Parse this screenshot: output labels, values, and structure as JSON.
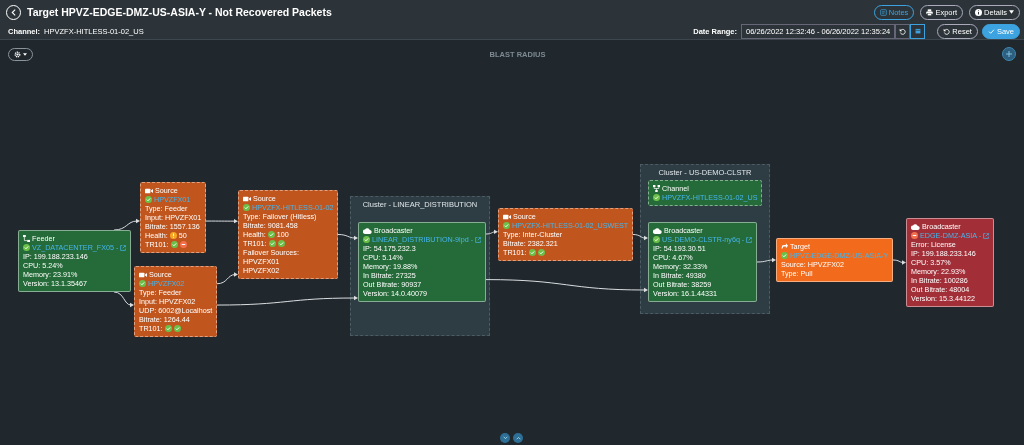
{
  "header": {
    "title": "Target HPVZ-EDGE-DMZ-US-ASIA-Y - Not Recovered Packets",
    "buttons": [
      {
        "kind": "notes",
        "label": "Notes"
      },
      {
        "kind": "export",
        "label": "Export"
      },
      {
        "kind": "details",
        "label": "Details"
      }
    ]
  },
  "filter": {
    "channel_label": "Channel:",
    "channel": "HPVZFX-HITLESS-01-02_US",
    "date_label": "Date Range:",
    "date_range": "06/26/2022 12:32:46 - 06/26/2022 12:35:24",
    "buttons": [
      {
        "kind": "reset",
        "label": "Reset"
      },
      {
        "kind": "save",
        "label": "Save"
      }
    ]
  },
  "canvas": {
    "title": "BLAST RADIUS"
  },
  "clusters": [
    {
      "title": "Cluster - LINEAR_DISTRIBUTION"
    },
    {
      "title": "Cluster - US-DEMO-CLSTR"
    }
  ],
  "nodes": [
    {
      "kind": "feeder",
      "label": "Feeder",
      "color": "#256b39",
      "ok": true,
      "name": "VZ_DATACENTER_FX05 -",
      "link": true,
      "lines": [
        {
          "text": "IP: 199.188.233.146"
        },
        {
          "text": "CPU: 5.24%"
        },
        {
          "text": "Memory: 23.91%"
        },
        {
          "text": "Version: 13.1.35467"
        }
      ]
    },
    {
      "kind": "source",
      "label": "Source",
      "color": "#c0561e",
      "ok": true,
      "name": "HPVZFX01",
      "link": false,
      "lines": [
        {
          "text": "Type: Feeder"
        },
        {
          "text": "Input: HPVZFX01"
        },
        {
          "text": "Bitrate: 1557.136"
        },
        {
          "text": "Health:",
          "icons": [
            {
              "kind": "warning"
            }
          ],
          "value": "50"
        },
        {
          "text": "TR101:",
          "icons": [
            {
              "kind": "ok"
            },
            {
              "kind": "error"
            }
          ]
        }
      ]
    },
    {
      "kind": "source",
      "label": "Source",
      "color": "#c0561e",
      "ok": true,
      "name": "HPVZFX02",
      "link": false,
      "lines": [
        {
          "text": "Type: Feeder"
        },
        {
          "text": "Input: HPVZFX02"
        },
        {
          "text": "UDP: 6002@Localhost"
        },
        {
          "text": "Bitrate: 1264.44"
        },
        {
          "text": "TR101:",
          "icons": [
            {
              "kind": "ok"
            },
            {
              "kind": "ok"
            }
          ]
        }
      ]
    },
    {
      "kind": "source",
      "label": "Source",
      "color": "#c0561e",
      "ok": true,
      "name": "HPVZFX-HITLESS-01-02",
      "link": false,
      "lines": [
        {
          "text": "Type: Failover (Hitless)"
        },
        {
          "text": "Bitrate: 9081.458"
        },
        {
          "text": "Health:",
          "icons": [
            {
              "kind": "ok"
            }
          ],
          "value": "100"
        },
        {
          "text": "TR101:",
          "icons": [
            {
              "kind": "ok"
            },
            {
              "kind": "ok"
            }
          ]
        },
        {
          "text": "Failover Sources:"
        },
        {
          "text": "HPVZFX01"
        },
        {
          "text": "HPVZFX02"
        }
      ]
    },
    {
      "kind": "broadcaster",
      "label": "Broadcaster",
      "color": "#256b39",
      "ok": true,
      "name": "LINEAR_DISTRIBUTION-9lpd -",
      "link": true,
      "lines": [
        {
          "text": "IP: 54.175.232.3"
        },
        {
          "text": "CPU: 5.14%"
        },
        {
          "text": "Memory: 19.88%"
        },
        {
          "text": "In Bitrate: 27325"
        },
        {
          "text": "Out Bitrate: 90937"
        },
        {
          "text": "Version: 14.0.40079"
        }
      ]
    },
    {
      "kind": "source",
      "label": "Source",
      "color": "#c0561e",
      "ok": true,
      "name": "HPVZFX-HITLESS-01-02_USWEST",
      "link": false,
      "lines": [
        {
          "text": "Type: Inter-Cluster"
        },
        {
          "text": "Bitrate: 2382.321"
        },
        {
          "text": "TR101:",
          "icons": [
            {
              "kind": "ok"
            },
            {
              "kind": "ok"
            }
          ]
        }
      ]
    },
    {
      "kind": "channel",
      "label": "Channel",
      "color": "#256b39",
      "ok": true,
      "name": "HPVZFX-HITLESS-01-02_US",
      "link": false
    },
    {
      "kind": "broadcaster",
      "label": "Broadcaster",
      "color": "#256b39",
      "ok": true,
      "name": "US-DEMO-CLSTR-ny6q -",
      "link": true,
      "lines": [
        {
          "text": "IP: 54.193.30.51"
        },
        {
          "text": "CPU: 4.67%"
        },
        {
          "text": "Memory: 32.33%"
        },
        {
          "text": "In Bitrate: 49380"
        },
        {
          "text": "Out Bitrate: 38259"
        },
        {
          "text": "Version: 16.1.44331"
        }
      ]
    },
    {
      "kind": "target",
      "label": "Target",
      "color": "#f26a1b",
      "ok": true,
      "name": "HPVZ-EDGE-DMZ-US-ASIA-Y",
      "link": false,
      "lines": [
        {
          "text": "Source: HPVZFX02"
        },
        {
          "text": "Type: Pull"
        }
      ]
    },
    {
      "kind": "broadcaster",
      "label": "Broadcaster",
      "color": "#a22f38",
      "ok": false,
      "name": "EDGE-DMZ-ASIA -",
      "link": true,
      "lines": [
        {
          "text": "Error: License"
        },
        {
          "text": "IP: 199.188.233.146"
        },
        {
          "text": "CPU: 3.57%"
        },
        {
          "text": "Memory: 22.93%"
        },
        {
          "text": "In Bitrate: 100286"
        },
        {
          "text": "Out Bitrate: 48004"
        },
        {
          "text": "Version: 15.3.44122"
        }
      ]
    }
  ]
}
